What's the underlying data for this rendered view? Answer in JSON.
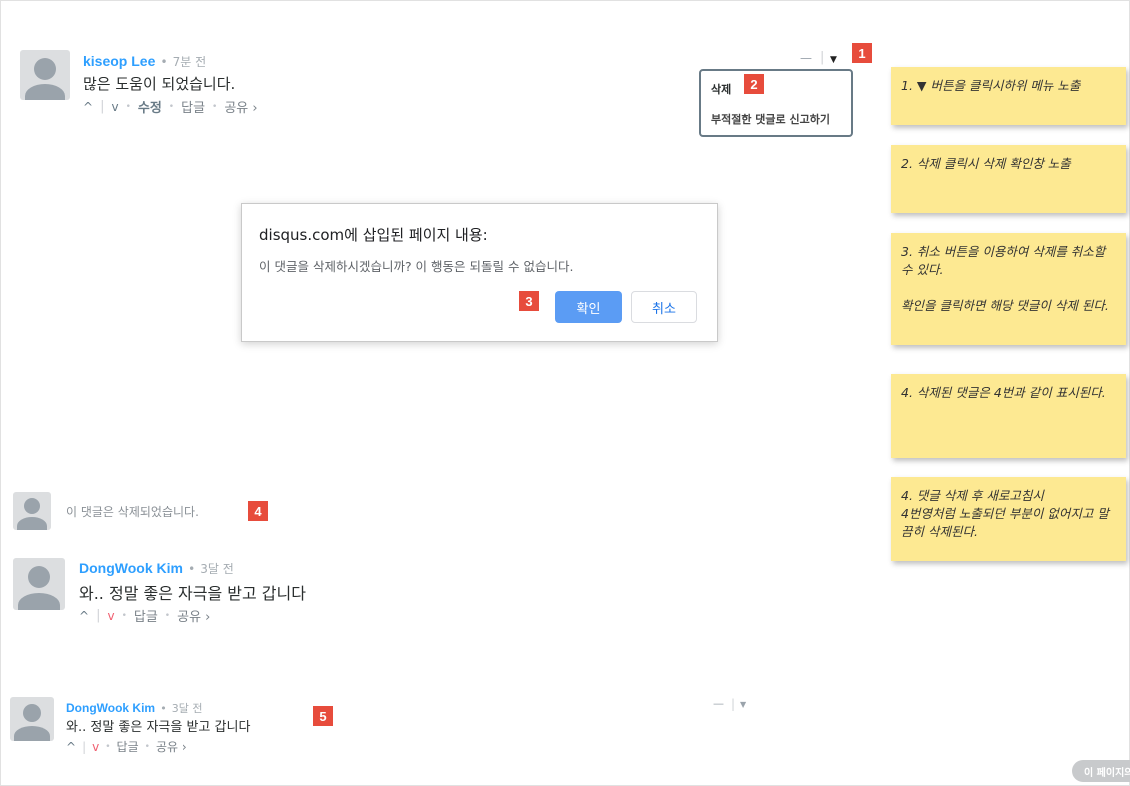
{
  "comment1": {
    "author": "kiseop Lee",
    "time": "7분 전",
    "text": "많은 도움이 되었습니다.",
    "actions": {
      "up": "^",
      "down": "v",
      "edit": "수정",
      "reply": "답글",
      "share": "공유 ›"
    },
    "collapse": "—",
    "menu_toggle": "▼"
  },
  "dropdown": {
    "delete": "삭제",
    "report": "부적절한 댓글로 신고하기"
  },
  "dialog": {
    "title": "disqus.com에 삽입된 페이지 내용:",
    "body": "이 댓글을 삭제하시겠습니까? 이 행동은 되돌릴 수 없습니다.",
    "ok": "확인",
    "cancel": "취소"
  },
  "deleted_comment": {
    "text": "이 댓글은 삭제되었습니다."
  },
  "comment2": {
    "author": "DongWook Kim",
    "time": "3달 전",
    "text": "와.. 정말 좋은 자극을 받고 갑니다",
    "actions": {
      "reply": "답글",
      "share": "공유 ›"
    }
  },
  "comment3": {
    "author": "DongWook Kim",
    "time": "3달 전",
    "text": "와.. 정말 좋은 자극을 받고 갑니다",
    "actions": {
      "reply": "답글",
      "share": "공유 ›"
    },
    "collapse": "—"
  },
  "markers": [
    "1",
    "2",
    "3",
    "4",
    "5"
  ],
  "notes": [
    "1. ▼ 버튼을 클릭시하위 메뉴 노출",
    "2. 삭제 클릭시 삭제 확인창 노출",
    "3. 취소 버튼을 이용하여 삭제를 취소할 수 있다.\n\n확인을 클릭하면 해당 댓글이 삭제 된다.",
    "4. 삭제된 댓글은 4번과 같이 표시된다.",
    "4. 댓글 삭제 후 새로고침시\n4번영처럼 노출되던 부분이 없어지고 말끔히 삭제된다."
  ],
  "page_pill": "이 페이지의",
  "colors": {
    "accent": "#2e9fff",
    "marker": "#e74c3c",
    "note": "#fde992",
    "ok_button": "#5b9cf4"
  }
}
